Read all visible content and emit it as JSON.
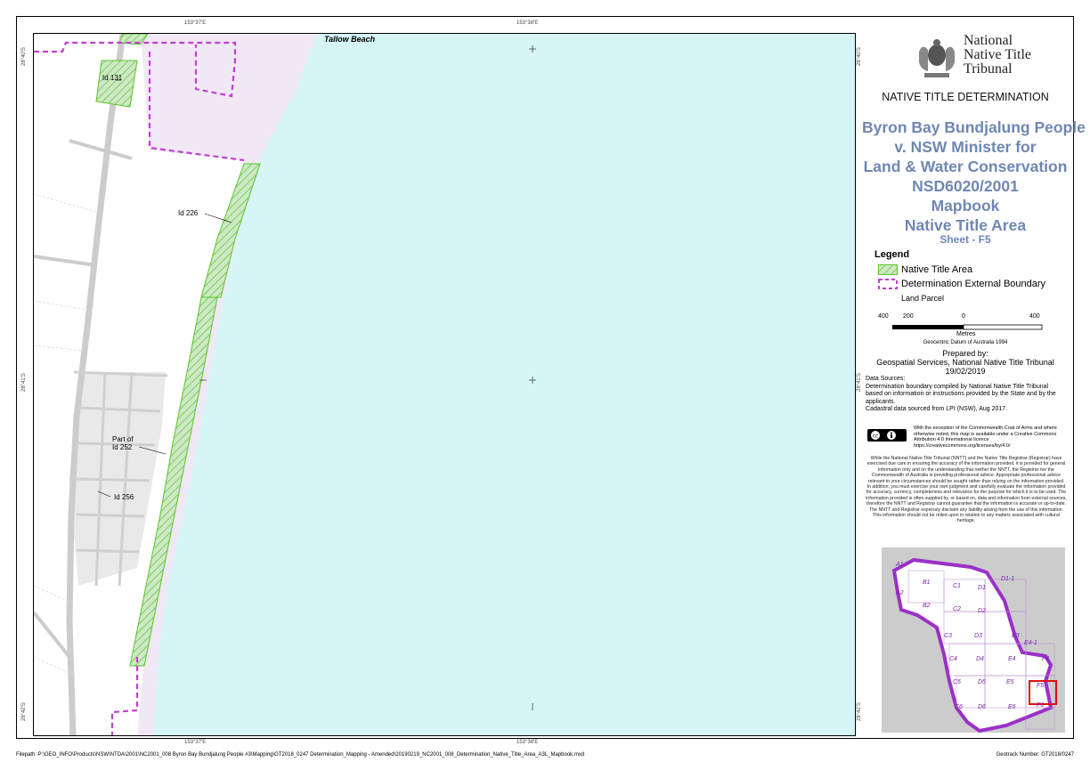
{
  "map": {
    "place_label": "Tallow Beach",
    "parcel_labels": [
      "Id 131",
      "Id 226",
      "Part of\nId 252",
      "Id 256"
    ],
    "coords": {
      "top_left": "153°37'E",
      "top_right": "153°38'E",
      "bottom_left": "153°37'E",
      "bottom_right": "153°38'E",
      "left_top": "28°40'S",
      "left_mid": "28°41'S",
      "left_bottom": "28°42'S",
      "right_top": "28°40'S",
      "right_mid": "28°41'S",
      "right_bottom": "28°42'S"
    },
    "colors": {
      "sea": "#d5f5f6",
      "boundary_zone": "#f1e8f6",
      "land": "#ffffff",
      "parcel_fill": "#cde8c6",
      "native_title": "#5cc52b",
      "boundary": "#c23fd2"
    }
  },
  "panel": {
    "org_lines": [
      "National",
      "Native Title",
      "Tribunal"
    ],
    "determination": "NATIVE TITLE DETERMINATION",
    "case_lines": [
      "Byron Bay Bundjalung People",
      "v. NSW Minister for",
      "Land & Water Conservation",
      "NSD6020/2001",
      "Mapbook",
      "Native Title Area"
    ],
    "sheet": "Sheet - F5",
    "legend": {
      "title": "Legend",
      "items": [
        "Native Title Area",
        "Determination External Boundary",
        "Land Parcel"
      ]
    },
    "scale": {
      "ticks": [
        "400",
        "200",
        "0",
        "400"
      ],
      "unit": "Metres"
    },
    "datum": "Geocentric Datum of Australia 1994",
    "prepared": [
      "Prepared by:",
      "Geospatial Services, National Native Title Tribunal",
      "19/02/2019"
    ],
    "sources": "Data Sources:\nDetermination boundary compiled by National Native Title Tribunal based on information or instructions provided by the State and by the applicants.\nCadastral data sourced from LPI (NSW), Aug 2017.",
    "cc_text": "With the exception of the Commonwealth Coat of Arms and where otherwise noted, this map is available under a Creative Commons Attribution 4.0 International licence https://creativecommons.org/licenses/by/4.0/",
    "disclaimer": "While the National Native Title Tribunal (NNTT) and the Native Title Registrar (Registrar) have exercised due care in ensuring the accuracy of the information provided, it is provided for general information only and on the understanding that neither the NNTT, the Registrar nor the Commonwealth of Australia is providing professional advice. Appropriate professional advice relevant to your circumstances should be sought rather than relying on the information provided. In addition, you must exercise your own judgment and carefully evaluate the information provided for accuracy, currency, completeness and relevance for the purpose for which it is to be used. The information provided is often supplied by, or based on, data and information from external sources, therefore the NNTT and Registrar cannot guarantee that the information is accurate or up-to-date. The NNTT and Registrar expressly disclaim any liability arising from the use of this information. This information should not be relied upon in relation to any matters associated with cultural heritage.",
    "keymap_sheets": [
      "A1",
      "A2",
      "B1",
      "B2",
      "C1",
      "C2",
      "C3",
      "C4",
      "C5",
      "C6",
      "D1",
      "D1-1",
      "D2",
      "D3",
      "D4",
      "D5",
      "D6",
      "E3",
      "E4",
      "E4-1",
      "E5",
      "E6",
      "F4",
      "F5",
      "F6"
    ]
  },
  "footer": {
    "filepath": "Filepath: P:\\GEO_INFO\\Products\\NSW\\NTDA\\2001\\NC2001_008 Byron Bay Bundjalung People #3\\Mapping\\GT2018_0247 Determination_Mapping - Amended\\20190219_NC2001_008_Determination_Native_Title_Area_A3L_Mapbook.mxd",
    "geotrack": "Geotrack Number: GT2018/0247"
  }
}
